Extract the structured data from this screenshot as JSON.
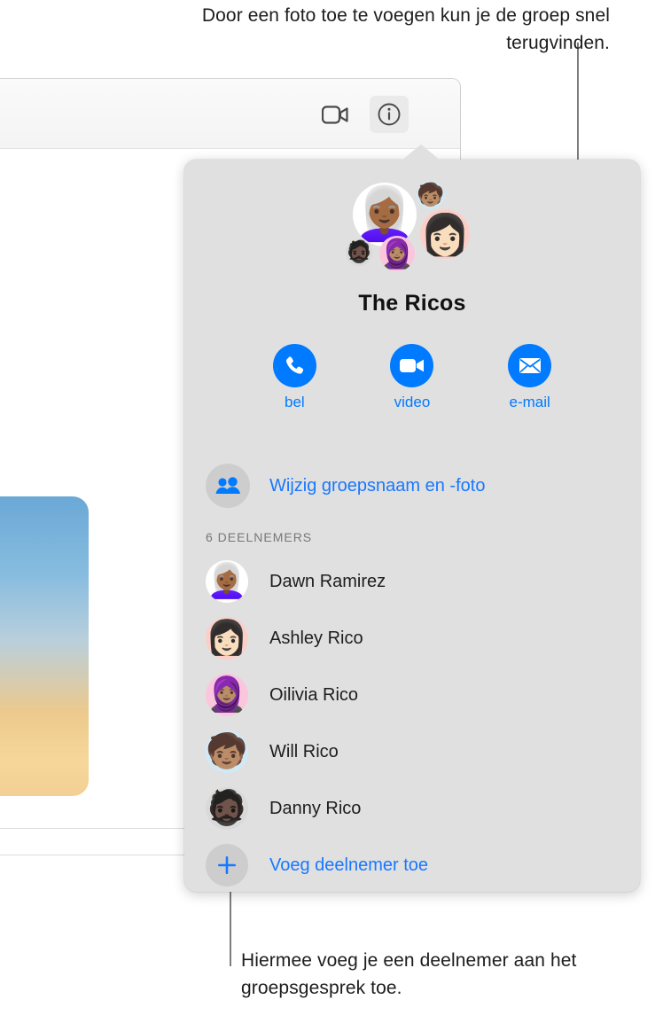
{
  "annotations": {
    "top": "Door een foto toe te voegen kun je de groep snel terugvinden.",
    "bottom": "Hiermee voeg je een deelnemer aan het groepsgesprek toe."
  },
  "toolbar": {
    "video_icon": "video-camera-icon",
    "info_icon": "info-circle-icon"
  },
  "popover": {
    "group_title": "The Ricos",
    "actions": [
      {
        "label": "bel",
        "icon": "phone-icon"
      },
      {
        "label": "video",
        "icon": "video-camera-icon"
      },
      {
        "label": "e-mail",
        "icon": "envelope-icon"
      }
    ],
    "change_name": {
      "label": "Wijzig groepsnaam en -foto",
      "icon": "two-people-icon"
    },
    "participants_heading": "6 DEELNEMERS",
    "participants": [
      {
        "name": "Dawn Ramirez",
        "avatar": "👩🏾‍🦳",
        "bg": "#ffffff"
      },
      {
        "name": "Ashley Rico",
        "avatar": "👩🏻",
        "bg": "#fbcfc8"
      },
      {
        "name": "Oilivia Rico",
        "avatar": "🧕🏽",
        "bg": "#fbc6dd"
      },
      {
        "name": "Will Rico",
        "avatar": "🧒🏽",
        "bg": "#cfeaf7"
      },
      {
        "name": "Danny Rico",
        "avatar": "🧔🏿",
        "bg": "#d9d9d9"
      }
    ],
    "add_participant": {
      "label": "Voeg deelnemer toe",
      "icon": "plus-icon"
    },
    "cluster": [
      {
        "name": "cluster-avatar-main",
        "avatar": "👩🏾‍🦳"
      },
      {
        "name": "cluster-avatar-top",
        "avatar": "🧒🏽"
      },
      {
        "name": "cluster-avatar-right",
        "avatar": "👩🏻"
      },
      {
        "name": "cluster-avatar-small",
        "avatar": "🧔🏿"
      },
      {
        "name": "cluster-avatar-pink",
        "avatar": "🧕🏽"
      }
    ]
  },
  "colors": {
    "accent_blue": "#007aff",
    "link_blue": "#1878ff",
    "popover_bg": "#e0e0e0",
    "leader_line": "#7d7d7d"
  }
}
